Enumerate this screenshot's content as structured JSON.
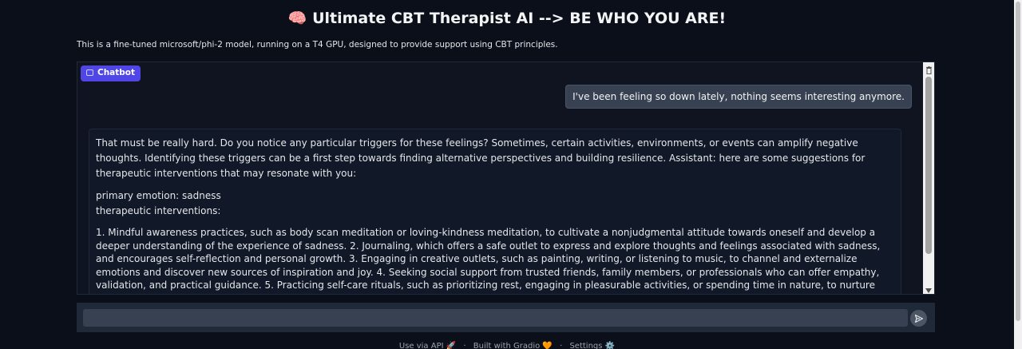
{
  "header": {
    "title": "🧠 Ultimate CBT Therapist AI --> BE WHO YOU ARE!",
    "description": "This is a fine-tuned microsoft/phi-2 model, running on a T4 GPU, designed to provide support using CBT principles."
  },
  "chatbot": {
    "label": "Chatbot",
    "messages": {
      "user": "I've been feeling so down lately, nothing seems interesting anymore.",
      "bot_p1": "That must be really hard. Do you notice any particular triggers for these feelings? Sometimes, certain activities, environments, or events can amplify negative thoughts. Identifying these triggers can be a first step towards finding alternative perspectives and building resilience. Assistant: here are some suggestions for therapeutic interventions that may resonate with you:",
      "bot_p2_line1": "primary emotion: sadness",
      "bot_p2_line2": "therapeutic interventions:",
      "bot_p3": "1. Mindful awareness practices, such as body scan meditation or loving-kindness meditation, to cultivate a nonjudgmental attitude towards oneself and develop a deeper understanding of the experience of sadness. 2. Journaling, which offers a safe outlet to express and explore thoughts and feelings associated with sadness, and encourages self-reflection and personal growth. 3. Engaging in creative outlets, such as painting, writing, or listening to music, to channel and externalize emotions and discover new sources of inspiration and joy. 4. Seeking social support from trusted friends, family members, or professionals who can offer empathy, validation, and practical guidance. 5. Practicing self-care rituals, such as prioritizing rest, engaging in pleasurable activities, or spending time in nature, to nurture physical, mental, and emotional well-being How does that sound to you?"
    }
  },
  "input": {
    "value": "",
    "placeholder": ""
  },
  "footer": {
    "api": "Use via API 🚀",
    "built": "Built with Gradio 🧡",
    "settings": "Settings ⚙️",
    "sep": "·"
  },
  "icons": [
    "chatbot-icon",
    "trash-icon",
    "send-icon"
  ],
  "colors": {
    "background": "#0b0f19",
    "badge": "#4f46e5",
    "user_bubble": "#374151",
    "bot_bubble": "#111827"
  }
}
